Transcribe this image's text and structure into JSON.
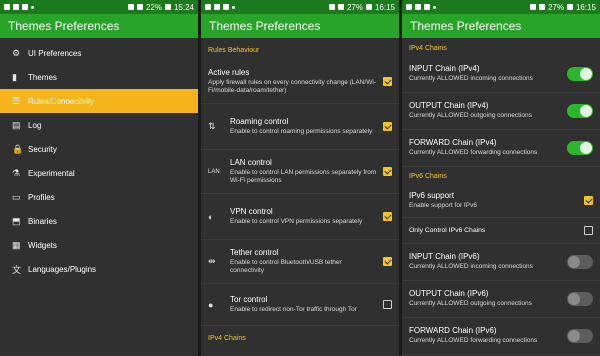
{
  "status": {
    "p1": {
      "battery": "22%",
      "time": "15:24"
    },
    "p2": {
      "battery": "27%",
      "time": "16:15"
    },
    "p3": {
      "battery": "27%",
      "time": "16:15"
    }
  },
  "app_title": "Themes Preferences",
  "nav": {
    "items": [
      {
        "label": "UI Preferences",
        "icon": "⚙"
      },
      {
        "label": "Themes",
        "icon": "▮"
      },
      {
        "label": "Rules/Connectivity",
        "icon": "☰"
      },
      {
        "label": "Log",
        "icon": "▤"
      },
      {
        "label": "Security",
        "icon": "🔒"
      },
      {
        "label": "Experimental",
        "icon": "⚗"
      },
      {
        "label": "Profiles",
        "icon": "▭"
      },
      {
        "label": "Binaries",
        "icon": "⬒"
      },
      {
        "label": "Widgets",
        "icon": "▦"
      },
      {
        "label": "Languages/Plugins",
        "icon": "文"
      }
    ],
    "active_index": 2
  },
  "rules": {
    "section": "Rules Behaviour",
    "items": [
      {
        "title": "Active rules",
        "desc": "Apply firewall rules on every connectivity change (LAN/Wi-Fi/mobile-data/roam/tether)",
        "checked": true,
        "icon": ""
      },
      {
        "title": "Roaming control",
        "desc": "Enable to control roaming permissions separately",
        "checked": true,
        "icon": "⇅"
      },
      {
        "title": "LAN control",
        "desc": "Enable to control LAN permissions separately from Wi-Fi permissions",
        "checked": true,
        "icon": "LAN"
      },
      {
        "title": "VPN control",
        "desc": "Enable to control VPN permissions separately",
        "checked": true,
        "icon": "◐"
      },
      {
        "title": "Tether control",
        "desc": "Enable to control Bluetooth/USB tether connectivity",
        "checked": true,
        "icon": "⇹"
      },
      {
        "title": "Tor control",
        "desc": "Enable to redirect non-Tor traffic through Tor",
        "checked": false,
        "icon": "●"
      }
    ],
    "footer_section": "IPv4 Chains"
  },
  "chains": {
    "ipv4_section": "IPv4 Chains",
    "ipv4": [
      {
        "title": "INPUT Chain (IPv4)",
        "desc": "Currently ALLOWED incoming connections",
        "on": true
      },
      {
        "title": "OUTPUT Chain (IPv4)",
        "desc": "Currently ALLOWED outgoing connections",
        "on": true
      },
      {
        "title": "FORWARD Chain (IPv4)",
        "desc": "Currently ALLOWED forwarding connections",
        "on": true
      }
    ],
    "ipv6_section": "IPv6 Chains",
    "ipv6_support": {
      "title": "IPv6 support",
      "desc": "Enable support for IPv6",
      "checked": true
    },
    "ipv6_only": {
      "title": "Only Control IPv6 Chains",
      "checked": false
    },
    "ipv6": [
      {
        "title": "INPUT Chain (IPv6)",
        "desc": "Currently ALLOWED incoming connections",
        "on": false
      },
      {
        "title": "OUTPUT Chain (IPv6)",
        "desc": "Currently ALLOWED outgoing connections",
        "on": false
      },
      {
        "title": "FORWARD Chain (IPv6)",
        "desc": "Currently ALLOWED forwarding connections",
        "on": false
      }
    ]
  }
}
